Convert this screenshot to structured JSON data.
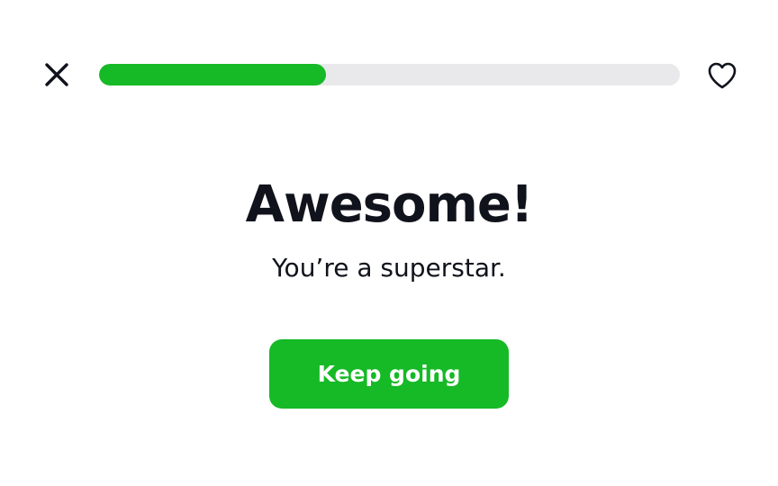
{
  "header": {
    "close_icon": "close-icon",
    "favorite_icon": "heart-outline-icon",
    "progress": {
      "value": 0.39,
      "fill_color": "#16b926",
      "track_color": "#e9e9ec"
    }
  },
  "main": {
    "title": "Awesome!",
    "subtitle": "You’re a superstar."
  },
  "actions": {
    "primary_label": "Keep going",
    "primary_color": "#16b926"
  }
}
